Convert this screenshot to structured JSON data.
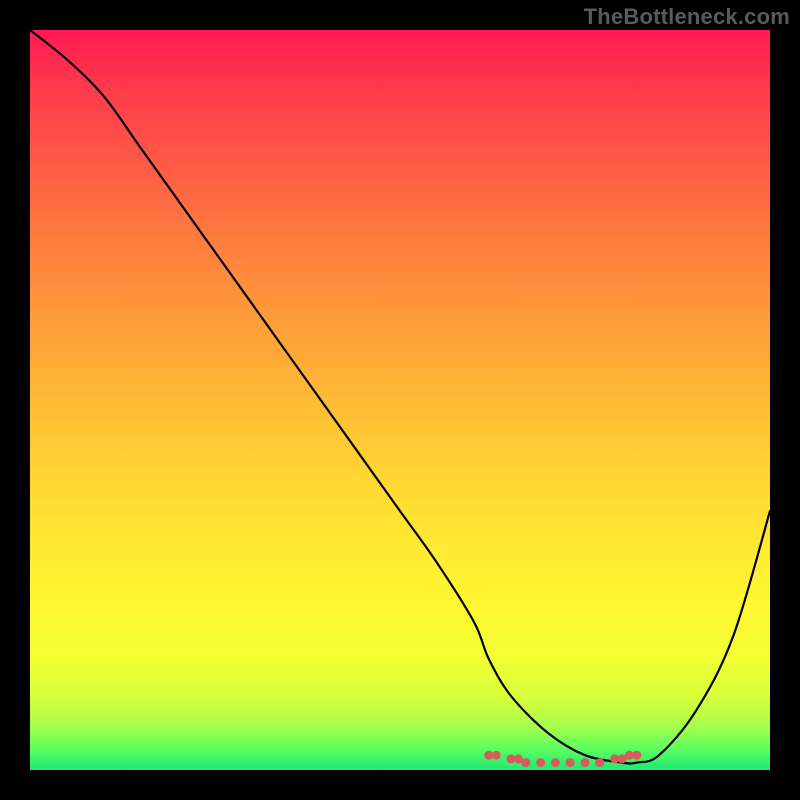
{
  "watermark": "TheBottleneck.com",
  "chart_data": {
    "type": "line",
    "title": "",
    "xlabel": "",
    "ylabel": "",
    "xlim": [
      0,
      100
    ],
    "ylim": [
      0,
      100
    ],
    "series": [
      {
        "name": "black-curve",
        "color": "#000000",
        "x": [
          0,
          5,
          10,
          15,
          20,
          25,
          30,
          35,
          40,
          45,
          50,
          55,
          60,
          62,
          65,
          70,
          75,
          80,
          82,
          85,
          90,
          95,
          100
        ],
        "values": [
          100,
          96,
          91,
          84,
          77,
          70,
          63,
          56,
          49,
          42,
          35,
          28,
          20,
          15,
          10,
          5,
          2,
          1,
          1,
          2,
          8,
          18,
          35
        ]
      },
      {
        "name": "red-dots",
        "color": "#d95a5a",
        "x": [
          62,
          63,
          65,
          66,
          67,
          69,
          71,
          73,
          75,
          77,
          79,
          80,
          81,
          82
        ],
        "values": [
          2,
          2,
          1.5,
          1.5,
          1,
          1,
          1,
          1,
          1,
          1,
          1.5,
          1.5,
          2,
          2
        ]
      }
    ],
    "gradient_stops": [
      {
        "pos": 0,
        "color": "#ff1a53"
      },
      {
        "pos": 50,
        "color": "#ffd033"
      },
      {
        "pos": 85,
        "color": "#f2ff33"
      },
      {
        "pos": 100,
        "color": "#20e874"
      }
    ]
  }
}
